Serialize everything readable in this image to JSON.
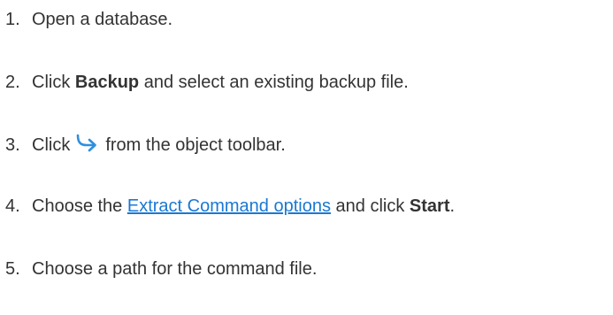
{
  "steps": [
    {
      "number": "1.",
      "text": "Open a database."
    },
    {
      "number": "2.",
      "pre": "Click ",
      "bold": "Backup",
      "post": " and select an existing backup file."
    },
    {
      "number": "3.",
      "pre": "Click",
      "icon": "extract-arrow-icon",
      "icon_color": "#2f8fe0",
      "post": "from the object toolbar."
    },
    {
      "number": "4.",
      "pre": "Choose the ",
      "link": "Extract Command options",
      "mid": " and click ",
      "bold": "Start",
      "post": "."
    },
    {
      "number": "5.",
      "text": "Choose a path for the command file."
    }
  ]
}
